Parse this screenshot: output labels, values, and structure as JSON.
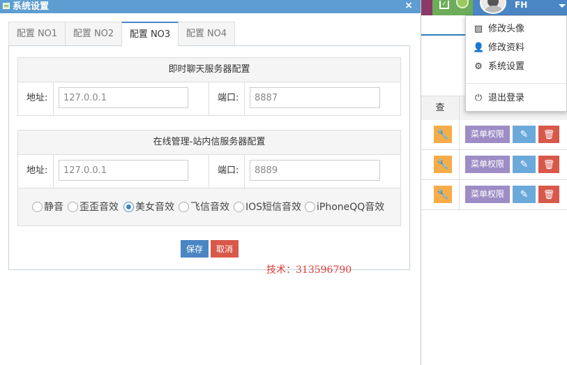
{
  "dialog": {
    "title": "系统设置",
    "close_glyph": "×"
  },
  "tabs": [
    {
      "label": "配置 NO1",
      "active": false
    },
    {
      "label": "配置 NO2",
      "active": false
    },
    {
      "label": "配置 NO3",
      "active": true
    },
    {
      "label": "配置 NO4",
      "active": false
    }
  ],
  "chat_server": {
    "heading": "即时聊天服务器配置",
    "address_label": "地址:",
    "address_value": "127.0.0.1",
    "port_label": "端口:",
    "port_value": "8887"
  },
  "message_server": {
    "heading": "在线管理-站内信服务器配置",
    "address_label": "地址:",
    "address_value": "127.0.0.1",
    "port_label": "端口:",
    "port_value": "8889"
  },
  "sound_options": [
    {
      "label": "静音",
      "checked": false
    },
    {
      "label": "歪歪音效",
      "checked": false
    },
    {
      "label": "美女音效",
      "checked": true
    },
    {
      "label": "飞信音效",
      "checked": false
    },
    {
      "label": "IOS短信音效",
      "checked": false
    },
    {
      "label": "iPhoneQQ音效",
      "checked": false
    }
  ],
  "buttons": {
    "save": "保存",
    "cancel": "取消"
  },
  "watermark": "技术：313596790",
  "user": {
    "name": "FH"
  },
  "user_menu": {
    "items": [
      {
        "label": "修改头像",
        "icon": "picture-icon"
      },
      {
        "label": "修改资料",
        "icon": "user-icon"
      },
      {
        "label": "系统设置",
        "icon": "gear-icon"
      },
      {
        "label": "退出登录",
        "icon": "power-icon"
      }
    ]
  },
  "background_table": {
    "column_header": "查",
    "rows": [
      {
        "menu_rights": "菜单权限"
      },
      {
        "menu_rights": "菜单权限"
      },
      {
        "menu_rights": "菜单权限"
      }
    ]
  },
  "colors": {
    "title_bar": "#5e9dd1",
    "primary": "#4a86c3",
    "danger": "#d8584a",
    "warning": "#f6ad48",
    "purple": "#9d8cc5",
    "info": "#6ca9db",
    "watermark": "#e23a3a"
  }
}
